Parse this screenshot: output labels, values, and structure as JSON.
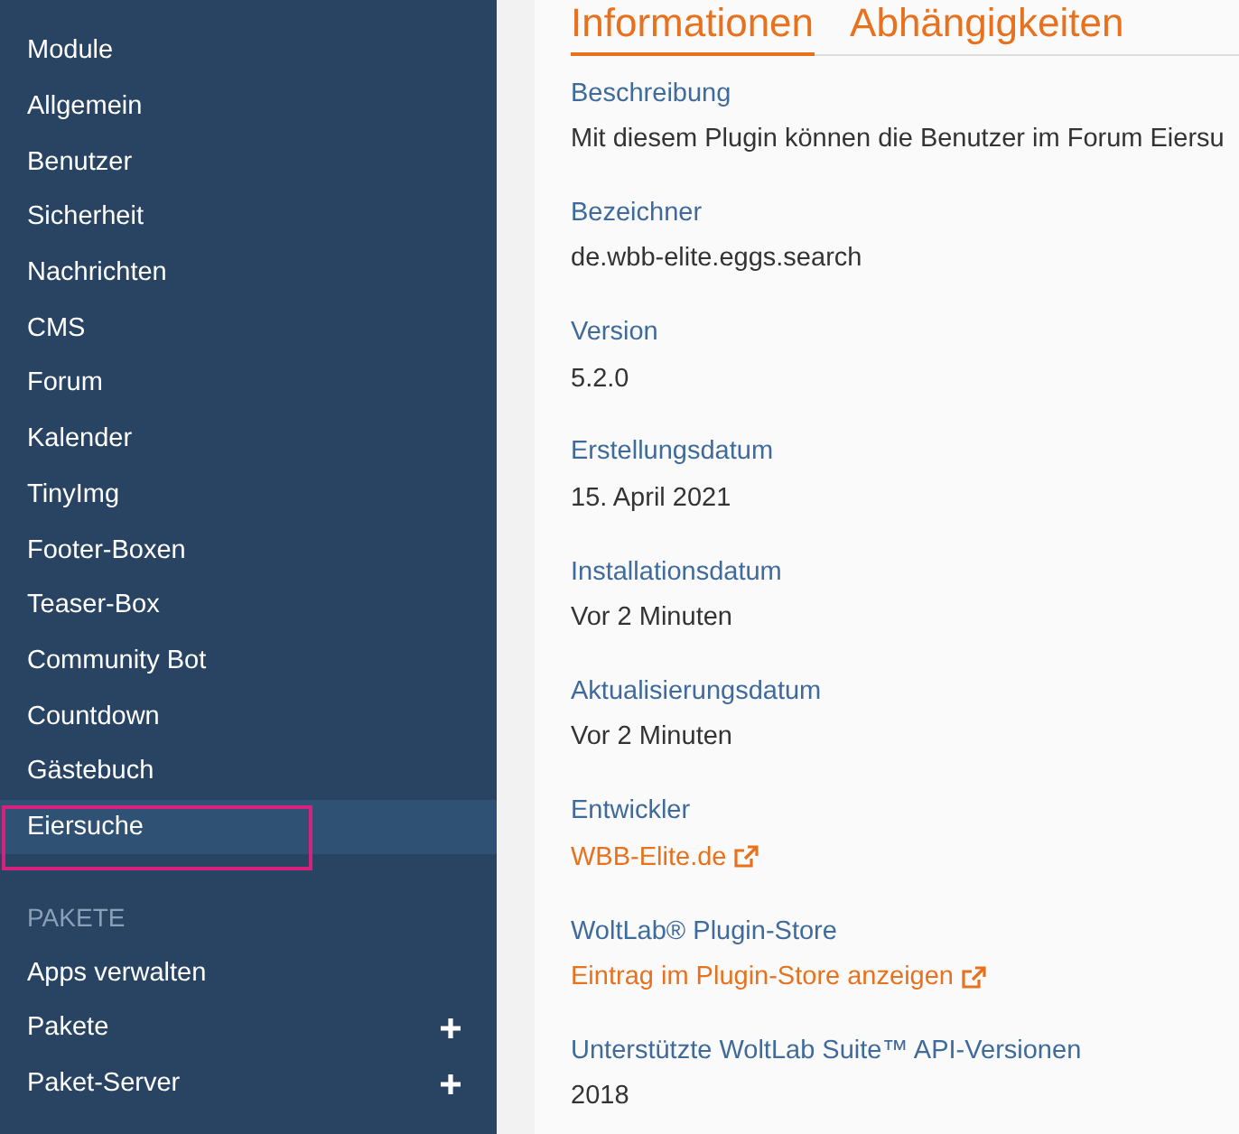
{
  "sidebar": {
    "sections": [
      {
        "items": [
          {
            "label": "Module",
            "selected": false,
            "expandable": false
          },
          {
            "label": "Allgemein",
            "selected": false,
            "expandable": false
          },
          {
            "label": "Benutzer",
            "selected": false,
            "expandable": false
          },
          {
            "label": "Sicherheit",
            "selected": false,
            "expandable": false
          },
          {
            "label": "Nachrichten",
            "selected": false,
            "expandable": false
          },
          {
            "label": "CMS",
            "selected": false,
            "expandable": false
          },
          {
            "label": "Forum",
            "selected": false,
            "expandable": false
          },
          {
            "label": "Kalender",
            "selected": false,
            "expandable": false
          },
          {
            "label": "TinyImg",
            "selected": false,
            "expandable": false
          },
          {
            "label": "Footer-Boxen",
            "selected": false,
            "expandable": false
          },
          {
            "label": "Teaser-Box",
            "selected": false,
            "expandable": false
          },
          {
            "label": "Community Bot",
            "selected": false,
            "expandable": false
          },
          {
            "label": "Countdown",
            "selected": false,
            "expandable": false
          },
          {
            "label": "Gästebuch",
            "selected": false,
            "expandable": false
          },
          {
            "label": "Eiersuche",
            "selected": true,
            "expandable": false,
            "highlighted": true
          }
        ]
      },
      {
        "title": "PAKETE",
        "items": [
          {
            "label": "Apps verwalten",
            "selected": false,
            "expandable": false
          },
          {
            "label": "Pakete",
            "selected": false,
            "expandable": true
          },
          {
            "label": "Paket-Server",
            "selected": false,
            "expandable": true
          }
        ]
      }
    ]
  },
  "tabs": [
    {
      "label": "Informationen",
      "selected": true
    },
    {
      "label": "Abhängigkeiten",
      "selected": false
    }
  ],
  "fields": [
    {
      "label": "Beschreibung",
      "value": "Mit diesem Plugin können die Benutzer im Forum Eiersu",
      "kind": "text"
    },
    {
      "label": "Bezeichner",
      "value": "de.wbb-elite.eggs.search",
      "kind": "text"
    },
    {
      "label": "Version",
      "value": "5.2.0",
      "kind": "text"
    },
    {
      "label": "Erstellungsdatum",
      "value": "15. April 2021",
      "kind": "text"
    },
    {
      "label": "Installationsdatum",
      "value": "Vor 2 Minuten",
      "kind": "text"
    },
    {
      "label": "Aktualisierungsdatum",
      "value": "Vor 2 Minuten",
      "kind": "text"
    },
    {
      "label": "Entwickler",
      "value": "WBB-Elite.de",
      "kind": "link"
    },
    {
      "label": "WoltLab® Plugin-Store",
      "value": "Eintrag im Plugin-Store anzeigen",
      "kind": "link"
    },
    {
      "label": "Unterstützte WoltLab Suite™ API-Versionen",
      "value": "2018",
      "kind": "text"
    }
  ]
}
